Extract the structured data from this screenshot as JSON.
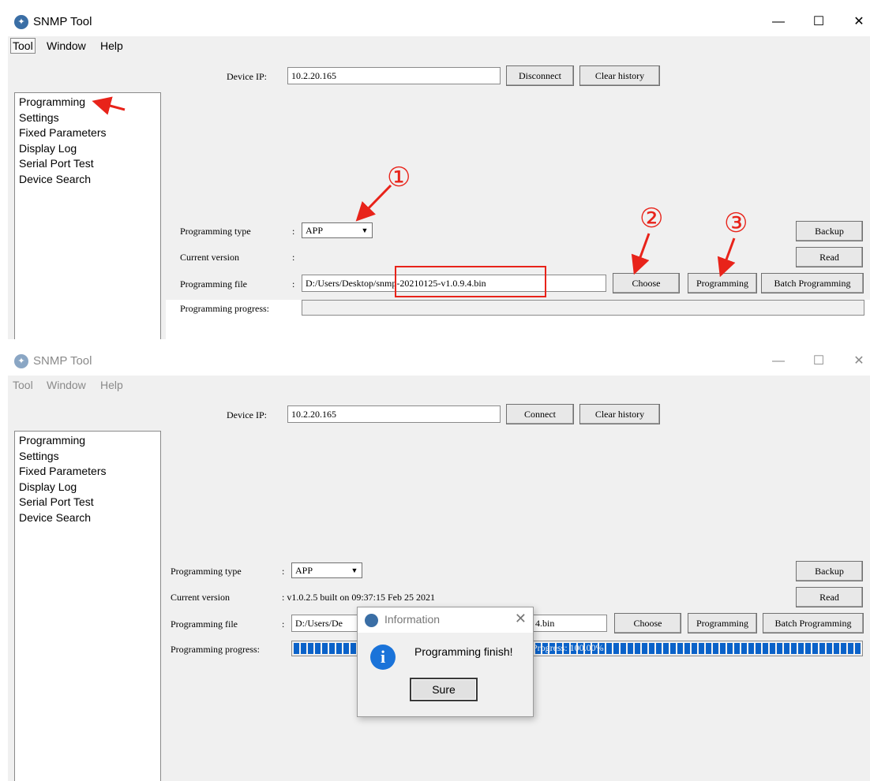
{
  "app": {
    "title": "SNMP Tool"
  },
  "window_controls": {
    "minimize": "—",
    "maximize": "☐",
    "close": "✕"
  },
  "menu": [
    "Tool",
    "Window",
    "Help"
  ],
  "sidebar": [
    "Programming",
    "Settings",
    "Fixed Parameters",
    "Display Log",
    "Serial Port Test",
    "Device Search"
  ],
  "top_panel": {
    "device_ip_label": "Device IP:",
    "device_ip": "10.2.20.165",
    "disconnect_label": "Disconnect",
    "clear_history_label": "Clear history",
    "programming_type_label": "Programming type",
    "programming_type_colon": ":",
    "programming_type_value": "APP",
    "current_version_label": "Current version",
    "current_version_colon": ":",
    "programming_file_label": "Programming file",
    "programming_file_colon": ":",
    "programming_file_value": "D:/Users/Desktop/snmp-20210125-v1.0.9.4.bin",
    "programming_progress_label": "Programming progress:",
    "choose_label": "Choose",
    "programming_label": "Programming",
    "batch_programming_label": "Batch Programming",
    "backup_label": "Backup",
    "read_label": "Read"
  },
  "annotations": {
    "step1": "①",
    "step2": "②",
    "step3": "③",
    "color": "#e8231a"
  },
  "bottom_panel": {
    "device_ip_label": "Device IP:",
    "device_ip": "10.2.20.165",
    "connect_label": "Connect",
    "clear_history_label": "Clear history",
    "programming_type_label": "Programming type",
    "programming_type_colon": ":",
    "programming_type_value": "APP",
    "current_version_label": "Current version",
    "current_version_value": ": v1.0.2.5 built on 09:37:15 Feb 25 2021",
    "programming_file_label": "Programming file",
    "programming_file_colon": ":",
    "programming_file_value_start": "D:/Users/De",
    "programming_file_value_end": "4.bin",
    "programming_progress_label": "Programming progress:",
    "progress_text": "Progress: 100.00%",
    "progress_fraction": 1.0,
    "choose_label": "Choose",
    "programming_label": "Programming",
    "batch_programming_label": "Batch Programming",
    "backup_label": "Backup",
    "read_label": "Read"
  },
  "dialog": {
    "title": "Information",
    "close": "✕",
    "icon": "i",
    "message": "Programming finish!",
    "ok_label": "Sure"
  },
  "colors": {
    "accent": "#0a62c9",
    "annotation_red": "#e8231a"
  }
}
